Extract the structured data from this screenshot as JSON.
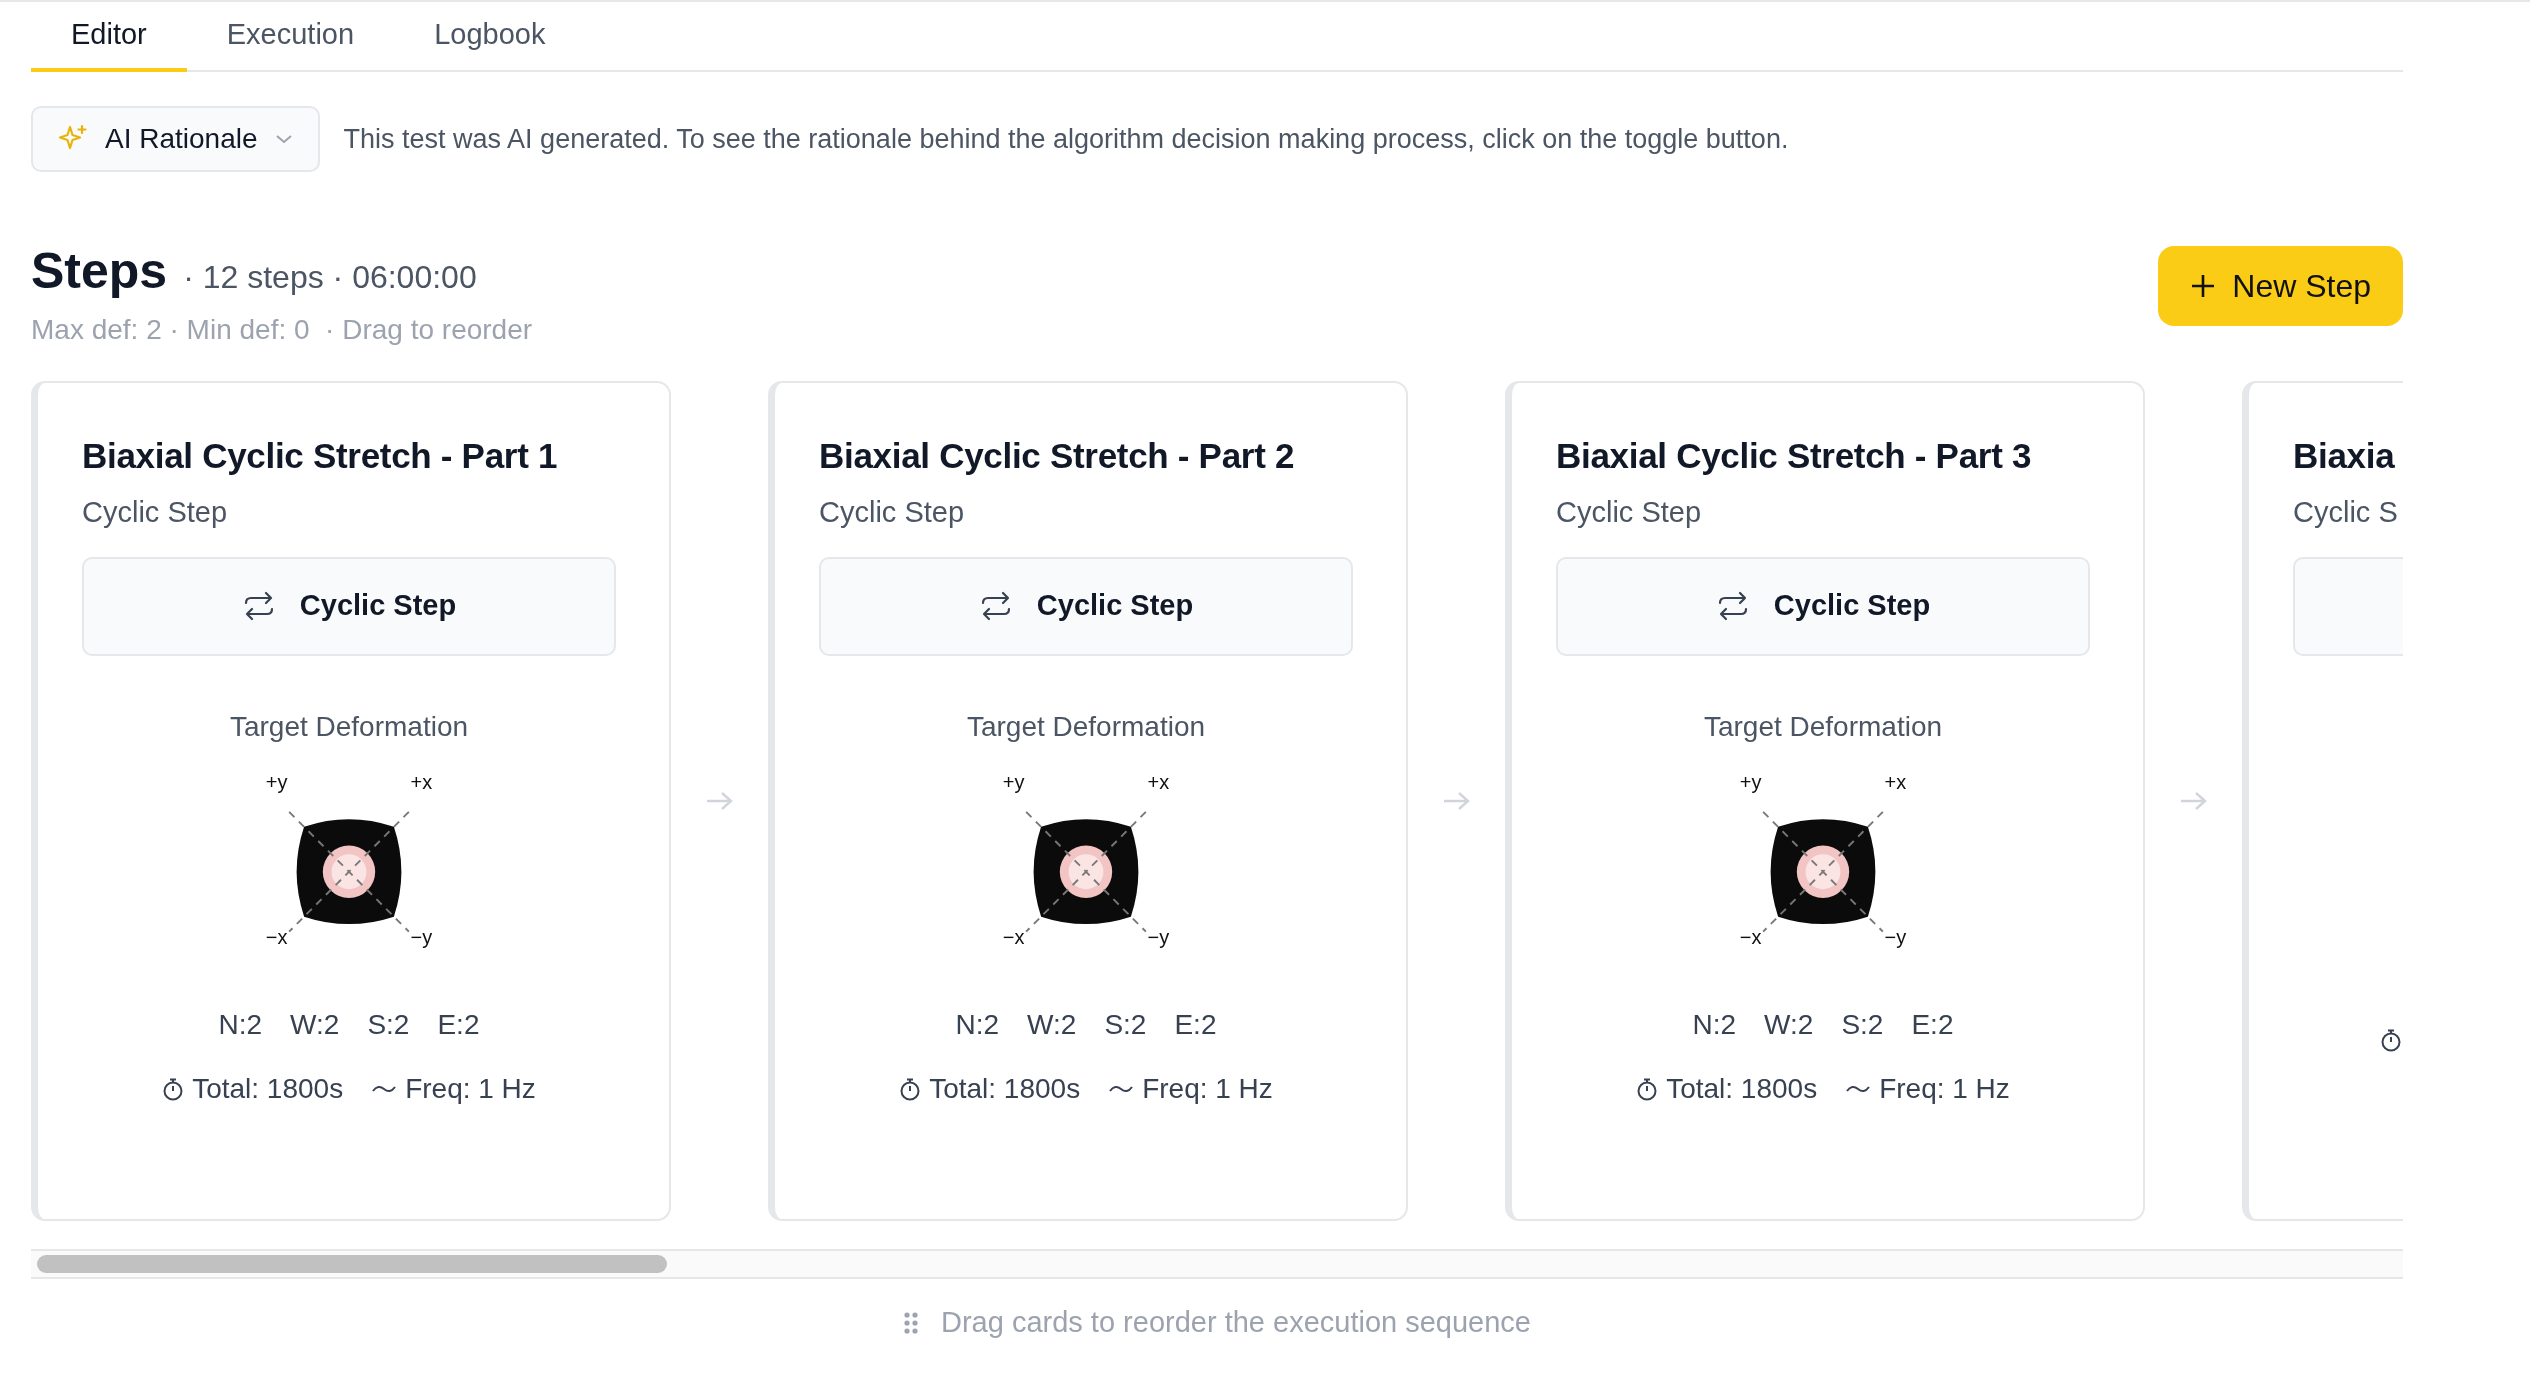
{
  "tabs": [
    {
      "label": "Editor",
      "selected": true
    },
    {
      "label": "Execution",
      "selected": false
    },
    {
      "label": "Logbook",
      "selected": false
    }
  ],
  "ai_rationale": {
    "label": "AI Rationale",
    "message": "This test was AI generated. To see the rationale behind the algorithm decision making process, click on the toggle button."
  },
  "steps": {
    "title": "Steps",
    "summary": "· 12 steps · 06:00:00",
    "details": "Max def: 2 · Min def: 0  · Drag to reorder",
    "new_button": "New Step"
  },
  "cards": [
    {
      "kind": "full",
      "title": "Biaxial Cyclic Stretch - Part 1",
      "subtitle": "Cyclic Step",
      "type_button": "Cyclic Step",
      "deformation_label": "Target Deformation",
      "axes": [
        "+y",
        "+x",
        "−x",
        "−y"
      ],
      "sides": [
        "N:2",
        "W:2",
        "S:2",
        "E:2"
      ],
      "total": "Total: 1800s",
      "freq": "Freq: 1 Hz"
    },
    {
      "kind": "full",
      "title": "Biaxial Cyclic Stretch - Part 2",
      "subtitle": "Cyclic Step",
      "type_button": "Cyclic Step",
      "deformation_label": "Target Deformation",
      "axes": [
        "+y",
        "+x",
        "−x",
        "−y"
      ],
      "sides": [
        "N:2",
        "W:2",
        "S:2",
        "E:2"
      ],
      "total": "Total: 1800s",
      "freq": "Freq: 1 Hz"
    },
    {
      "kind": "full",
      "title": "Biaxial Cyclic Stretch - Part 3",
      "subtitle": "Cyclic Step",
      "type_button": "Cyclic Step",
      "deformation_label": "Target Deformation",
      "axes": [
        "+y",
        "+x",
        "−x",
        "−y"
      ],
      "sides": [
        "N:2",
        "W:2",
        "S:2",
        "E:2"
      ],
      "total": "Total: 1800s",
      "freq": "Freq: 1 Hz"
    },
    {
      "kind": "clipped",
      "title": "Biaxia",
      "subtitle": "Cyclic S"
    }
  ],
  "footer": "Drag cards to reorder the execution sequence"
}
